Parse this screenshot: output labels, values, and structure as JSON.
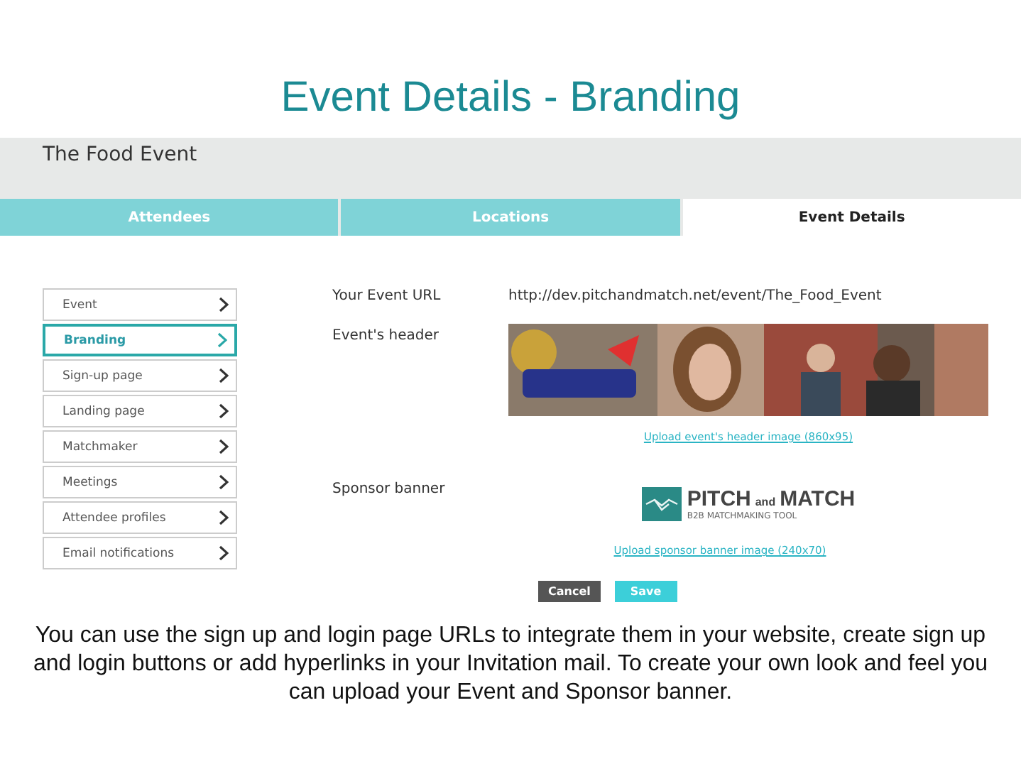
{
  "slide_title": "Event Details - Branding",
  "app": {
    "event_name": "The Food Event",
    "tabs": [
      {
        "label": "Attendees",
        "selected": false
      },
      {
        "label": "Locations",
        "selected": false
      },
      {
        "label": "Event Details",
        "selected": true
      }
    ],
    "sidebar": {
      "items": [
        {
          "label": "Event",
          "selected": false
        },
        {
          "label": "Branding",
          "selected": true
        },
        {
          "label": "Sign-up page",
          "selected": false
        },
        {
          "label": "Landing page",
          "selected": false
        },
        {
          "label": "Matchmaker",
          "selected": false
        },
        {
          "label": "Meetings",
          "selected": false
        },
        {
          "label": "Attendee profiles",
          "selected": false
        },
        {
          "label": "Email notifications",
          "selected": false
        }
      ]
    },
    "form": {
      "url_label": "Your Event URL",
      "url_value": "http://dev.pitchandmatch.net/event/The_Food_Event",
      "header_label": "Event's header",
      "header_upload_link": "Upload event's header image (860x95)",
      "sponsor_label": "Sponsor banner",
      "sponsor_logo": {
        "word_1": "PITCH",
        "joiner": "and",
        "word_2": "MATCH",
        "tagline": "B2B MATCHMAKING TOOL"
      },
      "sponsor_upload_link": "Upload sponsor banner image (240x70)",
      "buttons": [
        {
          "label": "Cancel",
          "kind": "secondary"
        },
        {
          "label": "Save",
          "kind": "primary"
        }
      ]
    }
  },
  "caption": "You can use the sign up and login page URLs to integrate them in your website, create sign up and login buttons or add hyperlinks in your Invitation mail. To create your own look and feel you can upload your Event and Sponsor banner."
}
